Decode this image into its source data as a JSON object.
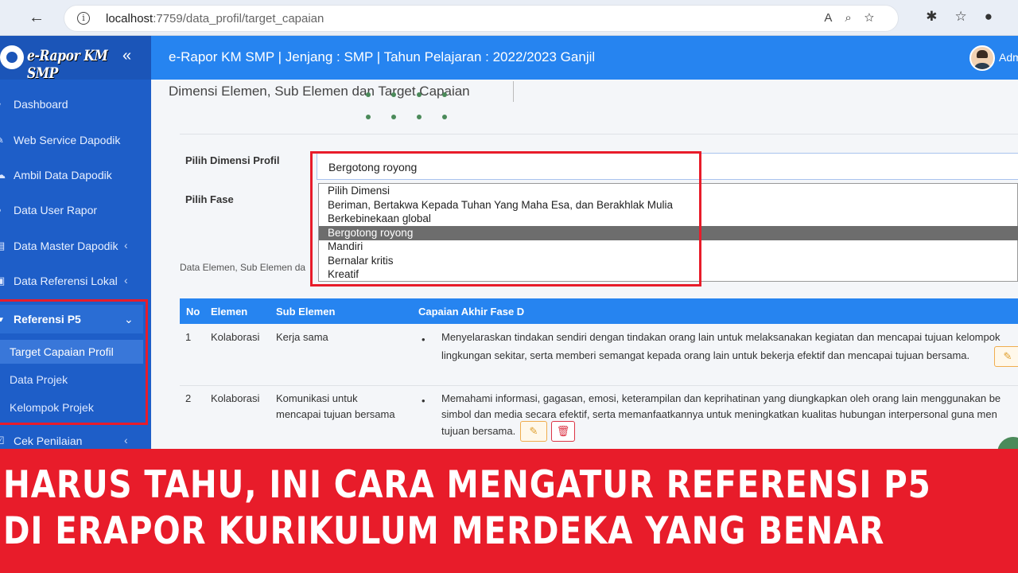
{
  "browser": {
    "url_host": "localhost",
    "url_rest": ":7759/data_profil/target_capaian",
    "back_icon": "back-arrow-icon",
    "toolbar_icons": [
      "read-aloud-icon",
      "zoom-icon",
      "favorite-add-icon",
      "extensions-icon",
      "favorites-icon",
      "profile-icon"
    ]
  },
  "sidebar": {
    "brand": "e-Rapor KM SMP",
    "items": [
      {
        "label": "Dashboard",
        "icon": "dashboard-icon"
      },
      {
        "label": "Web Service Dapodik",
        "icon": "wrench-icon"
      },
      {
        "label": "Ambil Data Dapodik",
        "icon": "cloud-download-icon"
      },
      {
        "label": "Data User Rapor",
        "icon": "user-icon"
      },
      {
        "label": "Data Master Dapodik",
        "icon": "database-icon",
        "caret": "‹"
      },
      {
        "label": "Data Referensi Lokal",
        "icon": "folder-icon",
        "caret": "‹"
      }
    ],
    "group": {
      "label": "Referensi P5",
      "caret": "⌄",
      "children": [
        {
          "label": "Target Capaian Profil",
          "active": true
        },
        {
          "label": "Data Projek",
          "active": false
        },
        {
          "label": "Kelompok Projek",
          "active": false
        }
      ]
    },
    "after": {
      "label": "Cek Penilaian",
      "caret": "‹"
    }
  },
  "topbar": {
    "title": "e-Rapor KM SMP | Jenjang : SMP | Tahun Pelajaran : 2022/2023 Ganjil",
    "user": "Adm"
  },
  "page": {
    "title": "Dimensi Elemen, Sub Elemen dan Target Capaian",
    "dimensi_label": "Pilih Dimensi Profil",
    "fase_label": "Pilih Fase",
    "selected_dimensi": "Bergotong royong",
    "dimensi_options": [
      "Pilih Dimensi",
      "Beriman, Bertakwa Kepada Tuhan Yang Maha Esa, dan Berakhlak Mulia",
      "Berkebinekaan global",
      "Bergotong royong",
      "Mandiri",
      "Bernalar kritis",
      "Kreatif"
    ],
    "selected_index": 3,
    "section_note": "Data Elemen, Sub Elemen da"
  },
  "table": {
    "headers": [
      "No",
      "Elemen",
      "Sub Elemen",
      "Capaian Akhir Fase D"
    ],
    "rows": [
      {
        "no": "1",
        "elemen": "Kolaborasi",
        "sub_elemen": "Kerja sama",
        "capaian_line1": "Menyelaraskan tindakan sendiri dengan tindakan orang lain untuk melaksanakan kegiatan dan mencapai tujuan kelompok",
        "capaian_line2": "lingkungan sekitar, serta memberi semangat kepada orang lain untuk bekerja efektif dan mencapai tujuan bersama."
      },
      {
        "no": "2",
        "elemen": "Kolaborasi",
        "sub_elemen_line1": "Komunikasi untuk",
        "sub_elemen_line2": "mencapai tujuan bersama",
        "capaian_line1": "Memahami informasi, gagasan, emosi, keterampilan dan keprihatinan yang diungkapkan oleh orang lain menggunakan be",
        "capaian_line2": "simbol dan media secara efektif, serta memanfaatkannya untuk meningkatkan kualitas hubungan interpersonal guna men",
        "capaian_line3": "tujuan bersama."
      }
    ],
    "edit_icon": "edit-icon",
    "delete_icon": "trash-icon"
  },
  "banner": {
    "line1": "HARUS TAHU, INI CARA MENGATUR REFERENSI P5",
    "line2": "DI ERAPOR KURIKULUM MERDEKA YANG BENAR",
    "color": "#e81c2a"
  }
}
